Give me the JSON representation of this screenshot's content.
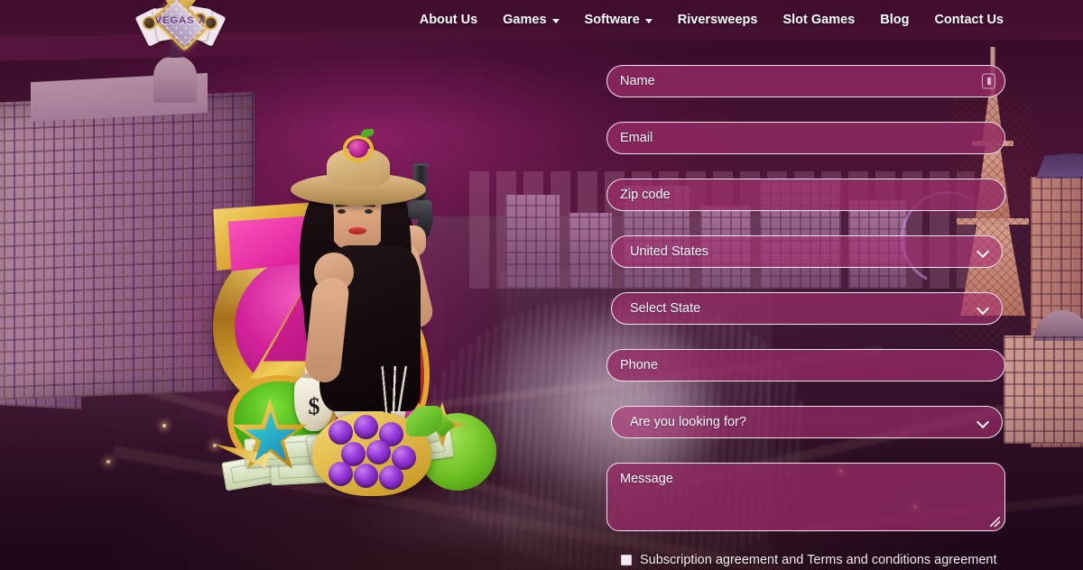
{
  "site": {
    "brand_name": "VEGAS X",
    "logo_icon": "vegas-marquee-diamond-logo"
  },
  "header": {
    "nav_items": [
      {
        "label": "About Us",
        "has_dropdown": false,
        "name": "about-us"
      },
      {
        "label": "Games",
        "has_dropdown": true,
        "name": "games"
      },
      {
        "label": "Software",
        "has_dropdown": true,
        "name": "software"
      },
      {
        "label": "Riversweeps",
        "has_dropdown": false,
        "name": "riversweeps"
      },
      {
        "label": "Slot Games",
        "has_dropdown": false,
        "name": "slot-games"
      },
      {
        "label": "Blog",
        "has_dropdown": false,
        "name": "blog"
      },
      {
        "label": "Contact Us",
        "has_dropdown": false,
        "name": "contact-us"
      }
    ],
    "dropdown_icon": "caret-down-icon",
    "background_color": "#430e30"
  },
  "form": {
    "fields": [
      {
        "type": "text",
        "placeholder": "Name",
        "value": "",
        "name": "name-input",
        "icon": "autofill-key-icon"
      },
      {
        "type": "email",
        "placeholder": "Email",
        "value": "",
        "name": "email-input"
      },
      {
        "type": "text",
        "placeholder": "Zip code",
        "value": "",
        "name": "zip-code-input"
      },
      {
        "type": "select",
        "placeholder": "United States",
        "value": "United States",
        "name": "country-select"
      },
      {
        "type": "select",
        "placeholder": "Select State",
        "value": "Select State",
        "name": "state-select"
      },
      {
        "type": "tel",
        "placeholder": "Phone",
        "value": "",
        "name": "phone-input"
      },
      {
        "type": "select",
        "placeholder": "Are you looking for?",
        "value": "Are you looking for?",
        "name": "looking-for-select"
      },
      {
        "type": "textarea",
        "placeholder": "Message",
        "value": "",
        "name": "message-textarea"
      }
    ],
    "agreement": {
      "label": "Subscription agreement and Terms and conditions agreement",
      "checked": false
    },
    "field_fill_color": "#942a64",
    "field_border_color": "#f2e2ee",
    "select_chevron_icon": "chevron-down-icon",
    "resize_handle_icon": "resize-grip-icon"
  },
  "hero": {
    "description": "Casino promo artwork: woman in straw hat holding a revolver, giant golden slot seven, money bags, shooting star, grapes symbol and cash stacks",
    "money_bag_symbol": "$",
    "elements": [
      "golden-seven",
      "money-bags",
      "shooting-star",
      "grapes-symbol",
      "green-gem",
      "cash-stack"
    ]
  },
  "background": {
    "description": "Las Vegas Strip aerial night photo in magenta/purple tint with Bellagio resort, fountains, Eiffel Tower replica and the High Roller wheel",
    "landmarks": [
      "bellagio-resort",
      "bellagio-fountains",
      "eiffel-tower",
      "high-roller-wheel"
    ],
    "sky_color": "#3a0a2a",
    "accent_color": "#e0219c"
  }
}
